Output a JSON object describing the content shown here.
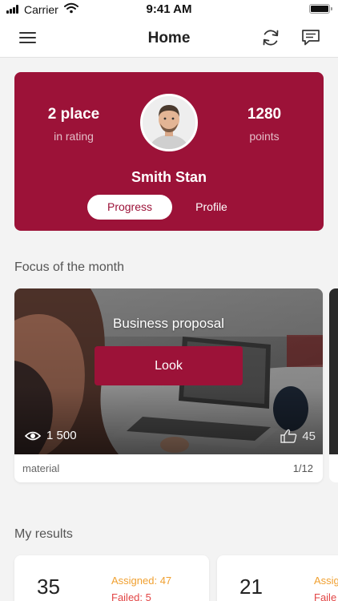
{
  "status_bar": {
    "carrier": "Carrier",
    "time": "9:41 AM"
  },
  "nav": {
    "title": "Home",
    "left_icon": "menu-icon",
    "right_icons": [
      "refresh-icon",
      "chat-icon"
    ]
  },
  "profile": {
    "rating_value": "2 place",
    "rating_label": "in rating",
    "points_value": "1280",
    "points_label": "points",
    "name": "Smith Stan",
    "tabs": [
      {
        "label": "Progress",
        "active": true
      },
      {
        "label": "Profile",
        "active": false
      }
    ]
  },
  "focus": {
    "section_title": "Focus of the month",
    "card": {
      "title": "Business proposal",
      "button_label": "Look",
      "views": "1 500",
      "likes": "45",
      "type": "material",
      "pager": "1/12"
    }
  },
  "results": {
    "section_title": "My results",
    "cards": [
      {
        "count": "35",
        "assigned": "Assigned: 47",
        "failed": "Failed: 5"
      },
      {
        "count": "21",
        "assigned": "Assig",
        "failed": "Faile"
      }
    ]
  },
  "colors": {
    "accent": "#9c1238",
    "background": "#f3f3f3",
    "assigned": "#f0a030",
    "failed": "#e24545"
  }
}
